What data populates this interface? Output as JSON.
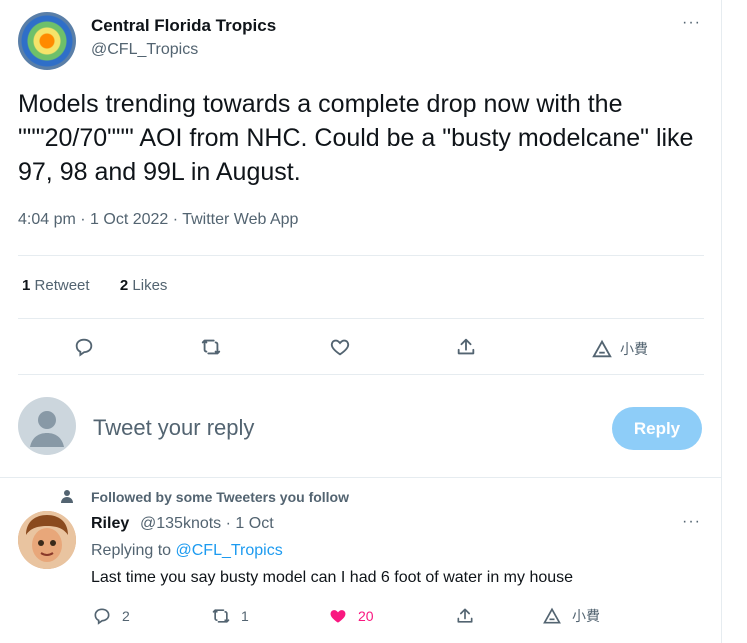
{
  "tweet": {
    "author_name": "Central Florida Tropics",
    "author_handle": "@CFL_Tropics",
    "text": "Models trending towards a complete drop now with the \"\"\"20/70\"\"\" AOI from NHC. Could be a \"busty modelcane\" like 97, 98 and 99L in August.",
    "meta": "4:04 pm · 1 Oct 2022 · Twitter Web App",
    "more": "···",
    "retweets_count": "1",
    "retweets_label": "Retweet",
    "likes_count": "2",
    "likes_label": "Likes",
    "actions": [
      {
        "icon": "reply-icon"
      },
      {
        "icon": "retweet-icon"
      },
      {
        "icon": "like-icon"
      },
      {
        "icon": "share-icon"
      },
      {
        "icon": "tip-icon",
        "label": "小費"
      }
    ]
  },
  "reply_box": {
    "placeholder": "Tweet your reply",
    "button_label": "Reply"
  },
  "reply": {
    "context": "Followed by some Tweeters you follow",
    "author_name": "Riley",
    "author_handle": "@135knots",
    "time": "· 1 Oct",
    "more": "···",
    "replying_prefix": "Replying to",
    "replying_to": "@CFL_Tropics",
    "text": "Last time you say busty model can I had 6 foot of water in my house",
    "reply_count": "2",
    "retweet_count": "1",
    "like_count": "20",
    "tip_label": "小費"
  },
  "colors": {
    "accent": "#1d9bf0",
    "like": "#f91880",
    "muted": "#536471",
    "reply_button": "#8ecdf8"
  }
}
